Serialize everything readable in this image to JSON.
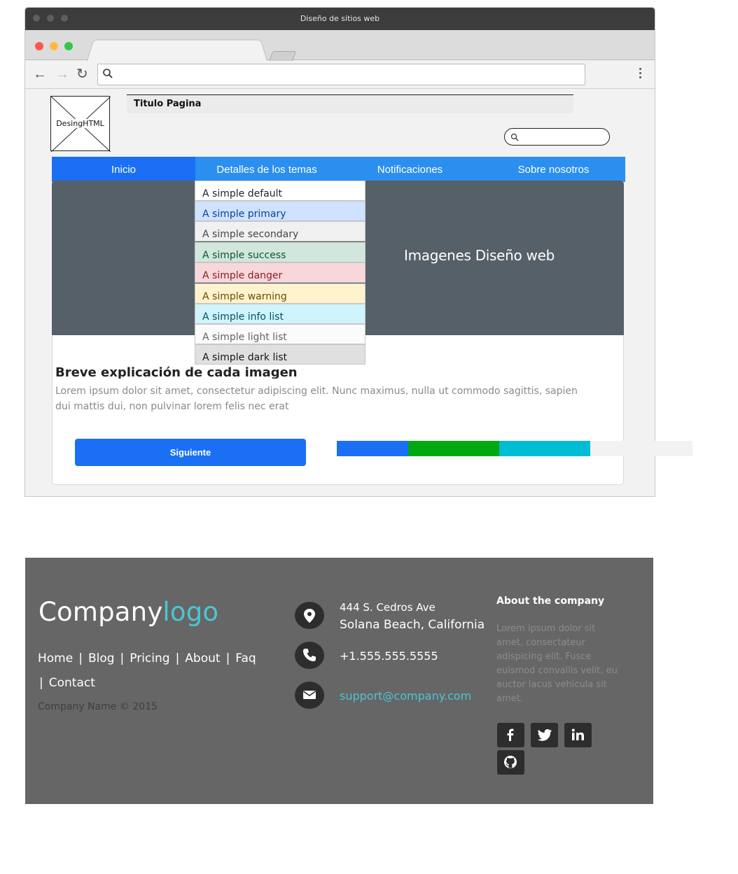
{
  "window": {
    "title": "Diseño de sitios web"
  },
  "header": {
    "logo_placeholder": "DesingHTML",
    "page_title": "Titulo Pagina",
    "search_placeholder": ""
  },
  "nav": {
    "items": [
      {
        "label": "Inicio",
        "active": true
      },
      {
        "label": "Detalles de los temas",
        "active": false
      },
      {
        "label": "Notificaciones",
        "active": false
      },
      {
        "label": "Sobre nosotros",
        "active": false
      }
    ]
  },
  "hero": {
    "text": "Imagenes Diseño web",
    "bg_color": "#566069"
  },
  "dropdown": {
    "items": [
      {
        "label": "A simple default",
        "bg": "#ffffff",
        "color": "#212529"
      },
      {
        "label": "A simple primary",
        "bg": "#cfe2ff",
        "color": "#084298"
      },
      {
        "label": "A simple secondary",
        "bg": "#f0f0f0",
        "color": "#41464b"
      },
      {
        "label": "A simple success",
        "bg": "#d1e7dd",
        "color": "#0f5132"
      },
      {
        "label": "A simple danger",
        "bg": "#f8d7da",
        "color": "#842029"
      },
      {
        "label": "A simple warning",
        "bg": "#fff3cd",
        "color": "#664d03"
      },
      {
        "label": "A simple info list",
        "bg": "#cff4fc",
        "color": "#055160"
      },
      {
        "label": "A simple light list",
        "bg": "#fbfbfb",
        "color": "#636464"
      },
      {
        "label": "A simple dark list",
        "bg": "#e0e0e0",
        "color": "#141619"
      }
    ]
  },
  "card": {
    "title": "Breve explicación de cada imagen",
    "text": "Lorem ipsum dolor sit amet, consectetur adipiscing elit. Nunc maximus, nulla ut commodo sagittis, sapien dui mattis dui, non pulvinar lorem felis nec erat",
    "button_label": "Siguiente"
  },
  "progress": {
    "segments": [
      {
        "value": 20,
        "color": "#1a6ff5"
      },
      {
        "value": 25.6,
        "color": "#00a812"
      },
      {
        "value": 25.6,
        "color": "#00bcd4"
      }
    ]
  },
  "footer": {
    "logo_main": "Company",
    "logo_accent": "logo",
    "links": [
      "Home",
      "Blog",
      "Pricing",
      "About",
      "Faq",
      "Contact"
    ],
    "copyright": "Company Name © 2015",
    "address_line1": "444 S. Cedros Ave",
    "address_line2": "Solana Beach, California",
    "phone": "+1.555.555.5555",
    "email": "support@company.com",
    "about_title": "About the company",
    "about_text": "Lorem ipsum dolor sit amet, consectateur adispicing elit. Fusce euismod convallis velit, eu auctor lacus vehicula sit amet.",
    "accent_color": "#4bc6d2",
    "social": [
      "facebook-icon",
      "twitter-icon",
      "linkedin-icon",
      "github-icon"
    ]
  }
}
